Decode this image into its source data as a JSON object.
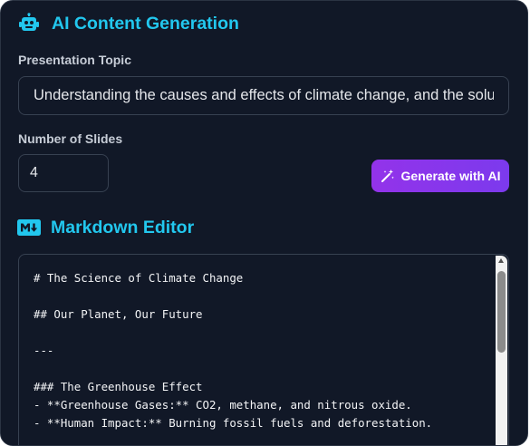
{
  "ai_section": {
    "title": "AI Content Generation",
    "icon": "robot-icon",
    "accent_color": "#22c7ee"
  },
  "topic": {
    "label": "Presentation Topic",
    "value": "Understanding the causes and effects of climate change, and the solutio"
  },
  "slides": {
    "label": "Number of Slides",
    "value": "4"
  },
  "generate_button": {
    "label": "Generate with AI",
    "icon": "magic-wand-icon",
    "gradient": [
      "#9333ea",
      "#7c3aed"
    ]
  },
  "editor_section": {
    "title": "Markdown Editor",
    "icon": "markdown-icon",
    "content": "# The Science of Climate Change\n\n## Our Planet, Our Future\n\n---\n\n### The Greenhouse Effect\n- **Greenhouse Gases:** CO2, methane, and nitrous oxide.\n- **Human Impact:** Burning fossil fuels and deforestation."
  }
}
